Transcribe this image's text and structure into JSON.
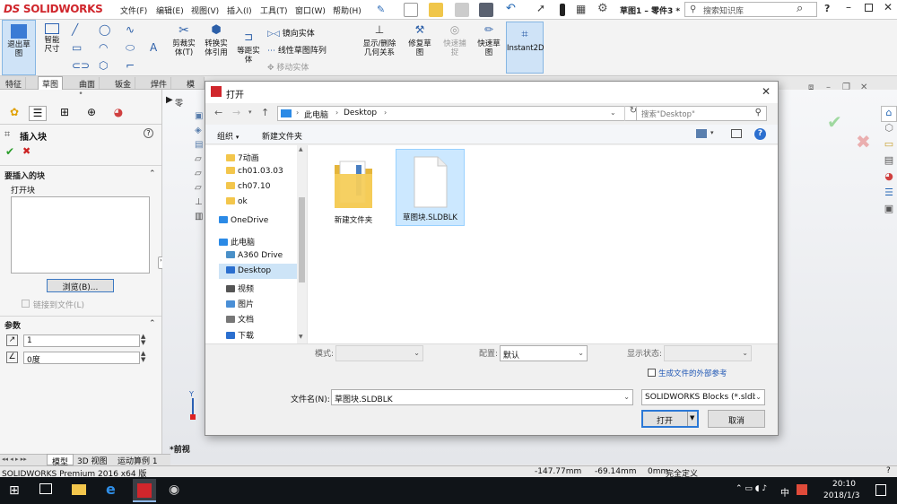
{
  "app": {
    "logo": "SOLIDWORKS",
    "menus": [
      "文件(F)",
      "编辑(E)",
      "视图(V)",
      "插入(I)",
      "工具(T)",
      "窗口(W)",
      "帮助(H)"
    ],
    "doc_title": "草图1 – 零件3 *",
    "search_placeholder": "搜索知识库"
  },
  "ribbon": {
    "buttons": [
      "退出草图",
      "智能尺寸",
      "剪裁实体(T)",
      "转换实体引用",
      "等距实体",
      "镜向实体",
      "线性草图阵列",
      "移动实体",
      "显示/删除几何关系",
      "修复草图",
      "快速捕捉",
      "快速草图",
      "Instant2D"
    ],
    "tabs": [
      "特征",
      "草图",
      "曲面",
      "钣金",
      "焊件",
      "模具"
    ]
  },
  "property_manager": {
    "title": "插入块",
    "section_block": "要插入的块",
    "open_block_label": "打开块",
    "browse_label": "浏览(B)...",
    "link_label": "链接到文件(L)",
    "section_params": "参数",
    "scale_value": "1",
    "angle_value": "0度"
  },
  "graphics": {
    "view_label": "*前视",
    "axis_y": "Y"
  },
  "bottom_tabs": [
    "模型",
    "3D 视图",
    "运动算例 1"
  ],
  "status": {
    "product": "SOLIDWORKS Premium 2016 x64 版",
    "x": "-147.77mm",
    "y": "-69.14mm",
    "z": "0mm",
    "state": "完全定义"
  },
  "taskbar": {
    "time": "20:10",
    "date": "2018/1/3",
    "ime": "中"
  },
  "dialog": {
    "title": "打开",
    "path": [
      "此电脑",
      "Desktop"
    ],
    "search_placeholder": "搜索\"Desktop\"",
    "organize": "组织",
    "new_folder": "新建文件夹",
    "nav_items": [
      {
        "label": "7动画",
        "type": "folder"
      },
      {
        "label": "ch01.03.03",
        "type": "folder"
      },
      {
        "label": "ch07.10",
        "type": "folder"
      },
      {
        "label": "ok",
        "type": "folder"
      },
      {
        "label": "OneDrive",
        "type": "cloud"
      },
      {
        "label": "此电脑",
        "type": "pc"
      },
      {
        "label": "A360 Drive",
        "type": "drive"
      },
      {
        "label": "Desktop",
        "type": "desktop"
      },
      {
        "label": "视频",
        "type": "video"
      },
      {
        "label": "图片",
        "type": "image"
      },
      {
        "label": "文档",
        "type": "doc"
      },
      {
        "label": "下载",
        "type": "download"
      }
    ],
    "files": [
      {
        "name": "新建文件夹",
        "type": "folder"
      },
      {
        "name": "草图块.SLDBLK",
        "type": "file"
      }
    ],
    "mode_label": "模式:",
    "config_label": "配置:",
    "config_value": "默认",
    "display_state_label": "显示状态:",
    "external_refs_label": "生成文件的外部参考",
    "filename_label": "文件名(N):",
    "filename_value": "草图块.SLDBLK",
    "filetype_value": "SOLIDWORKS Blocks (*.sldb",
    "open_button": "打开",
    "cancel_button": "取消"
  },
  "colors": {
    "brand": "#d0262c",
    "accent": "#0078d7",
    "folder": "#f3c64c"
  }
}
